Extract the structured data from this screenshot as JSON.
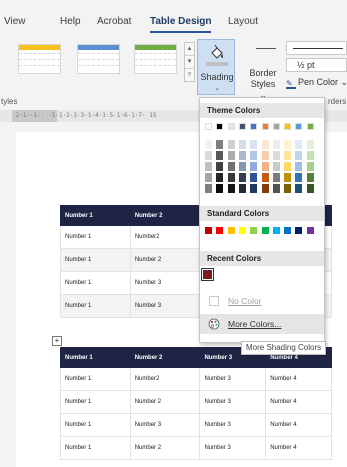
{
  "menu": {
    "items": [
      {
        "label": "View",
        "active": false
      },
      {
        "label": "Help",
        "active": false
      },
      {
        "label": "Acrobat",
        "active": false
      },
      {
        "label": "Table Design",
        "active": true
      },
      {
        "label": "Layout",
        "active": false
      }
    ]
  },
  "ribbon": {
    "shading_label": "Shading",
    "shading_caret": "⌄",
    "border_styles_label": "Border",
    "border_styles_label2": "Styles ⌄",
    "pen_weight": "½ pt",
    "pen_color_label": "Pen Color ⌄",
    "gallery_colors": [
      "#f6c21a",
      "#5b8fd0",
      "#70ad47"
    ]
  },
  "group_labels": {
    "left": "tyles",
    "right": "rders"
  },
  "ruler": {
    "text": "·2·1··1··  ·1·1·2·1·3·1·4·1·5·1·6·1·7·  15"
  },
  "dropdown": {
    "theme_colors_title": "Theme Colors",
    "standard_colors_title": "Standard Colors",
    "recent_colors_title": "Recent Colors",
    "no_color_label": "No Color",
    "more_colors_label": "More Colors...",
    "theme_top_row": [
      "#ffffff",
      "#000000",
      "#e7e6e6",
      "#44546a",
      "#4472c4",
      "#ed7d31",
      "#a5a5a5",
      "#ffc000",
      "#5b9bd5",
      "#70ad47"
    ],
    "theme_shades": [
      [
        "#f2f2f2",
        "#d9d9d9",
        "#bfbfbf",
        "#a6a6a6",
        "#808080"
      ],
      [
        "#7f7f7f",
        "#595959",
        "#404040",
        "#262626",
        "#0d0d0d"
      ],
      [
        "#d0cece",
        "#aeabab",
        "#757070",
        "#3a3838",
        "#171616"
      ],
      [
        "#d6dce4",
        "#adb9ca",
        "#8497b0",
        "#333f4f",
        "#222a35"
      ],
      [
        "#d9e2f3",
        "#b4c6e7",
        "#8eaadb",
        "#2f5496",
        "#1f3864"
      ],
      [
        "#fbe5d5",
        "#f7cbac",
        "#f4b083",
        "#c55a11",
        "#833c0b"
      ],
      [
        "#ededed",
        "#dbdbdb",
        "#c9c9c9",
        "#7b7b7b",
        "#525252"
      ],
      [
        "#fff2cc",
        "#fee599",
        "#ffd965",
        "#bf9000",
        "#7f6000"
      ],
      [
        "#deebf6",
        "#bdd7ee",
        "#9cc3e5",
        "#2e75b5",
        "#1e4e79"
      ],
      [
        "#e2efd9",
        "#c5e0b3",
        "#a8d08d",
        "#538135",
        "#375623"
      ]
    ],
    "standard_colors": [
      "#c00000",
      "#ff0000",
      "#ffc000",
      "#ffff00",
      "#92d050",
      "#00b050",
      "#00b0f0",
      "#0070c0",
      "#002060",
      "#7030a0"
    ],
    "recent_color": "#7a1f1f"
  },
  "tooltip": "More Shading Colors",
  "table1": {
    "header": [
      "Number 1",
      "Number 2",
      "",
      ""
    ],
    "rows": [
      [
        "Number 1",
        "Number2",
        "",
        ""
      ],
      [
        "Number 1",
        "Number 2",
        "",
        ""
      ],
      [
        "Number 1",
        "Number 3",
        "",
        ""
      ],
      [
        "Number 1",
        "Number 3",
        "",
        ""
      ]
    ]
  },
  "table2": {
    "header": [
      "Number 1",
      "Number 2",
      "Number 3",
      "Number 4"
    ],
    "rows": [
      [
        "Number 1",
        "Number2",
        "Number 3",
        "Number 4"
      ],
      [
        "Number 1",
        "Number 2",
        "Number 3",
        "Number 4"
      ],
      [
        "Number 1",
        "Number 3",
        "Number 3",
        "Number 4"
      ],
      [
        "Number 1",
        "Number 2",
        "Number 3",
        "Number 4"
      ]
    ]
  }
}
